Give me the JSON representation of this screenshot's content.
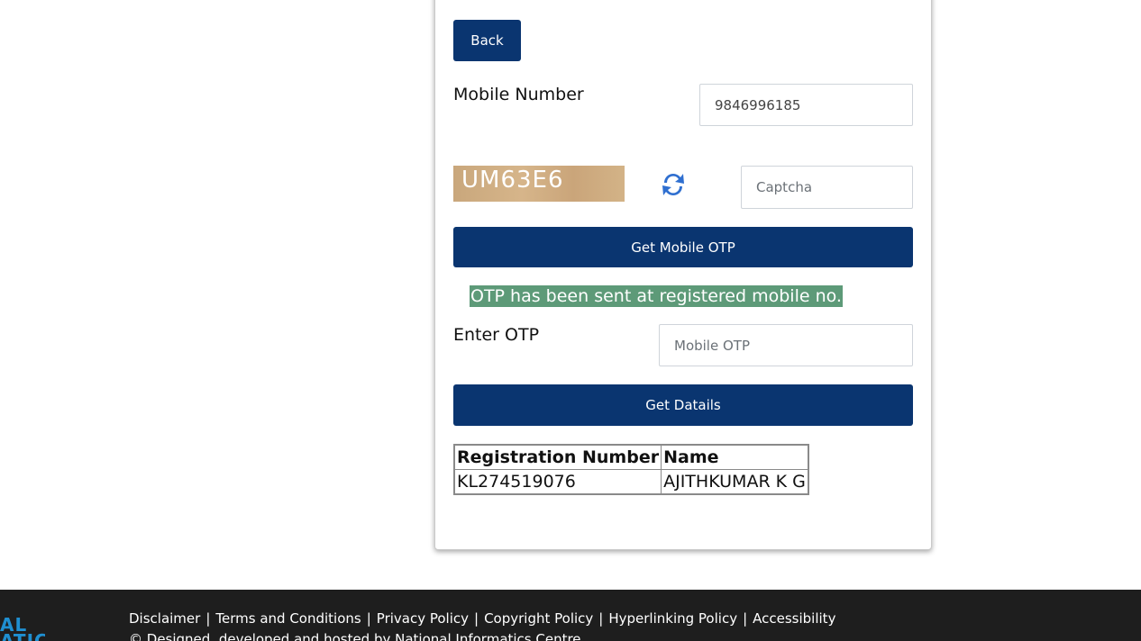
{
  "form": {
    "back_label": "Back",
    "mobile_label": "Mobile Number",
    "mobile_value": "9846996185",
    "captcha_text": "UM63E6",
    "captcha_placeholder": "Captcha",
    "refresh_icon": "refresh-icon",
    "get_otp_label": "Get Mobile OTP",
    "otp_message": "OTP has been sent at registered mobile no.",
    "enter_otp_label": "Enter OTP",
    "otp_placeholder": "Mobile OTP",
    "get_details_label": "Get Datails"
  },
  "results": {
    "headers": [
      "Registration Number",
      "Name"
    ],
    "rows": [
      [
        "KL274519076",
        "AJITHKUMAR K G"
      ]
    ]
  },
  "footer": {
    "logo_text": "AL\nATICS",
    "links": [
      "Disclaimer",
      "Terms and Conditions",
      "Privacy Policy",
      "Copyright Policy",
      "Hyperlinking Policy",
      "Accessibility"
    ],
    "copyright": "© Designed, developed and hosted by National Informatics Centre"
  },
  "colors": {
    "primary": "#0a3570",
    "success_bg": "#5d9a78",
    "footer_bg": "#1e1e1e"
  }
}
